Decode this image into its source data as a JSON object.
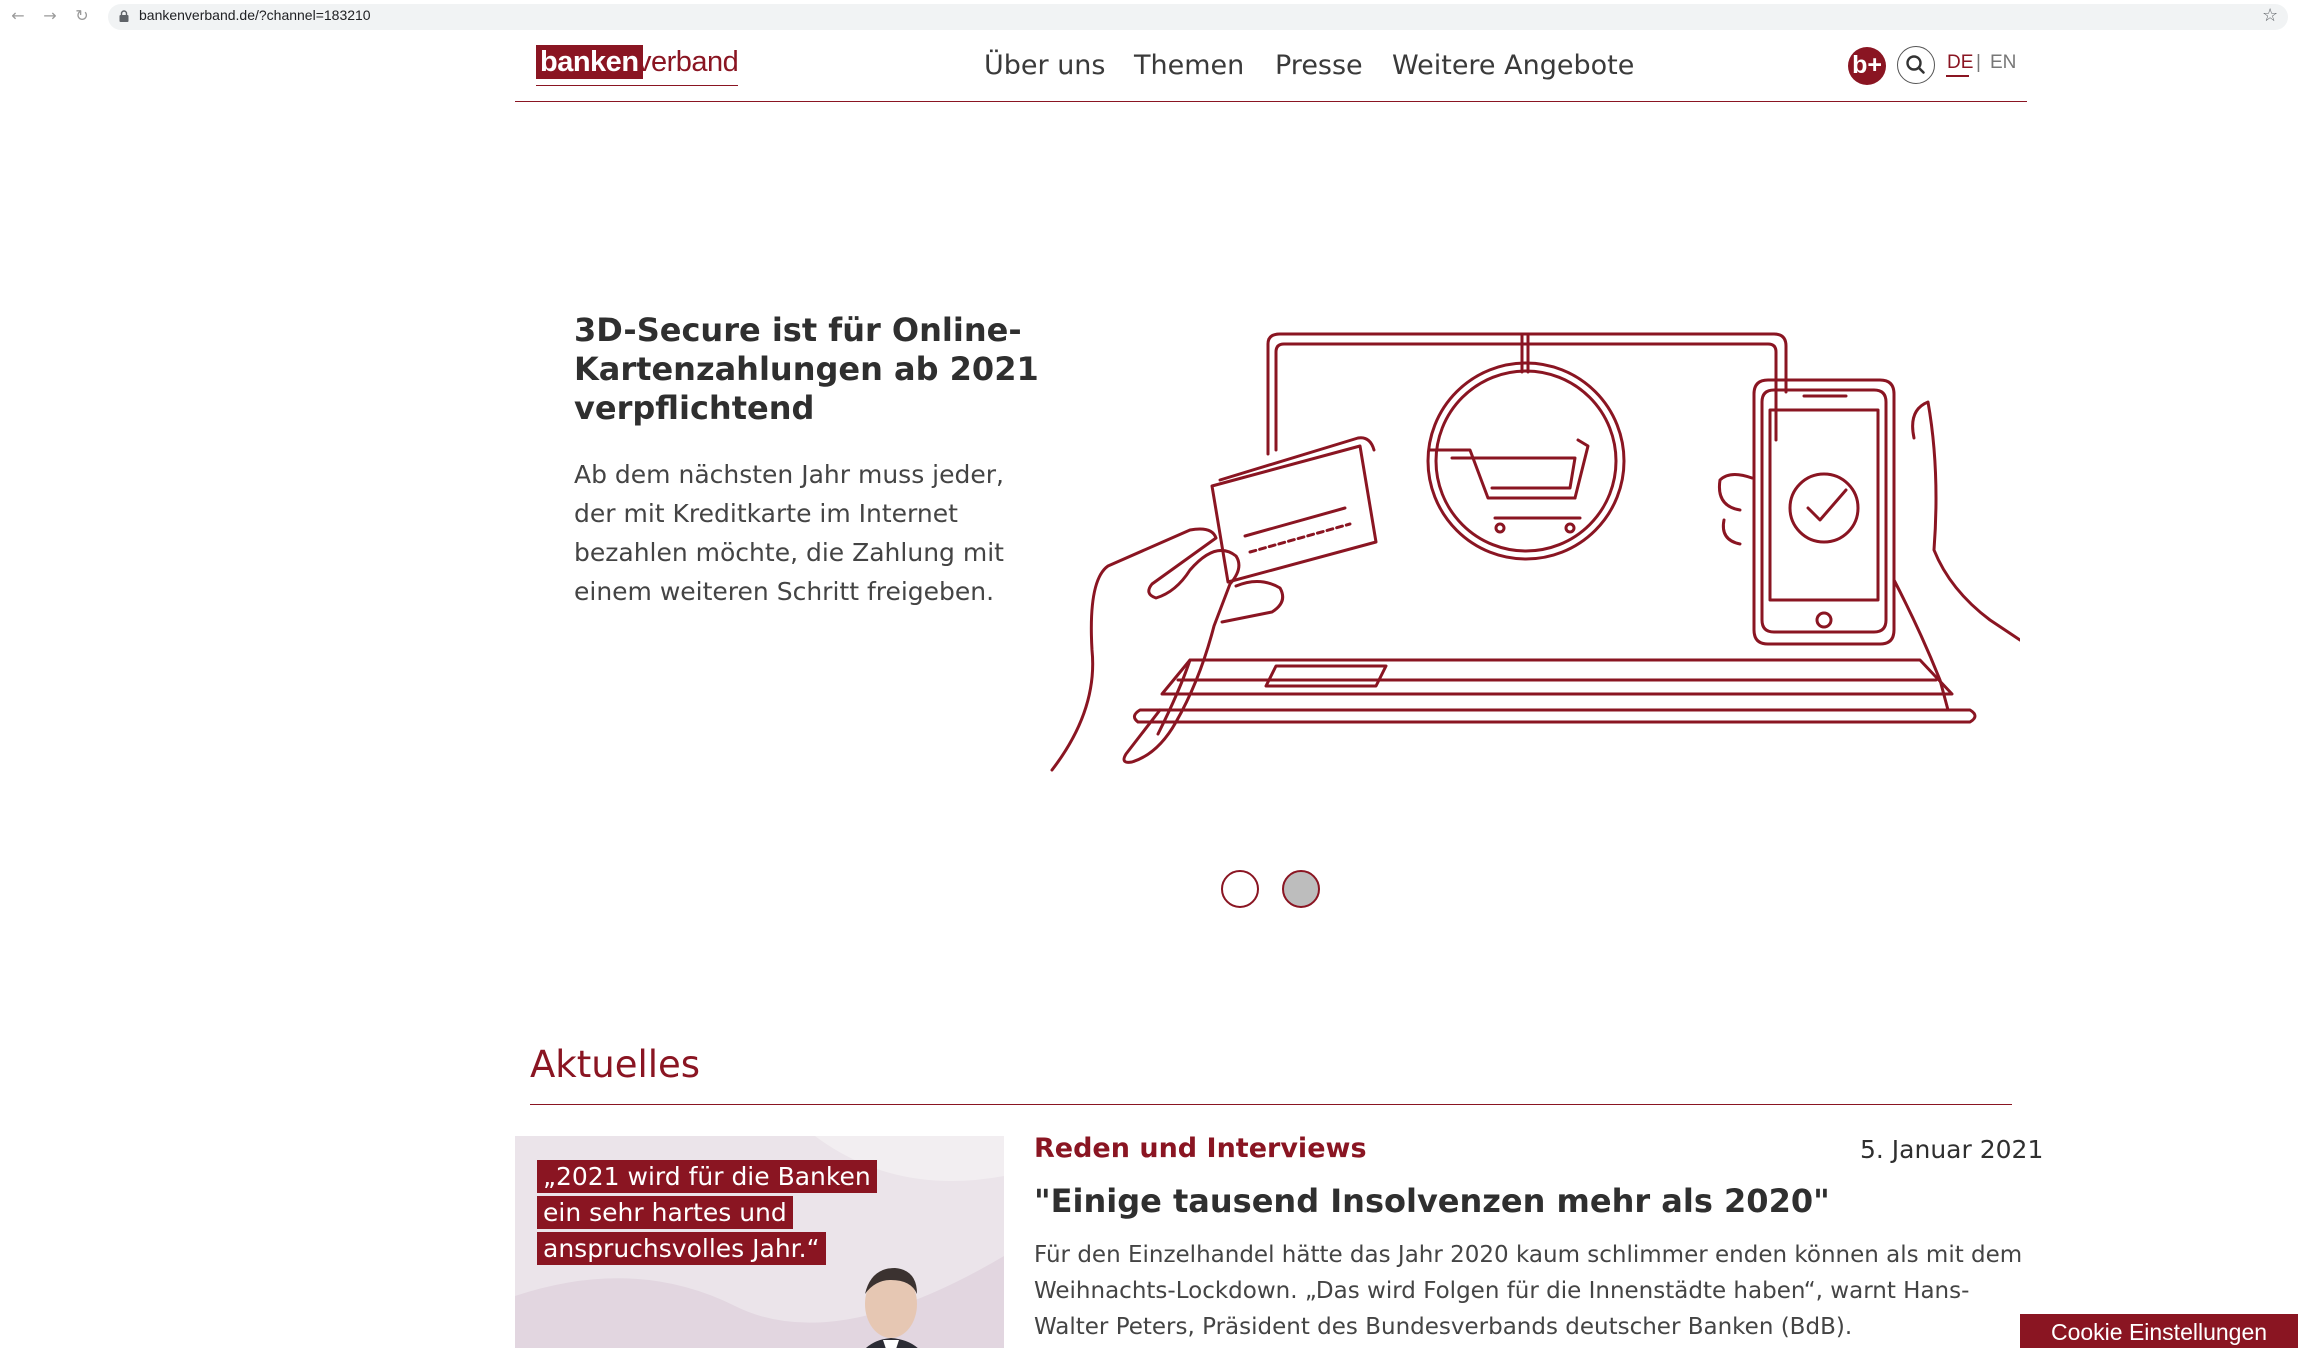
{
  "browser": {
    "url": "bankenverband.de/?channel=183210"
  },
  "header": {
    "logo": {
      "part1": "banken",
      "part2": "verband"
    },
    "nav": [
      "Über uns",
      "Themen",
      "Presse",
      "Weitere Angebote"
    ],
    "bplus_label": "b+",
    "lang": {
      "active": "DE",
      "separator": "|",
      "other": "EN"
    }
  },
  "hero": {
    "title": "3D-Secure ist für Online-Kartenzahlungen ab 2021 verpflichtend",
    "text": "Ab dem nächsten Jahr muss jeder, der mit Kreditkarte im Internet bezahlen möchte, die Zahlung mit einem weiteren Schritt freigeben.",
    "slides_total": 2,
    "slide_active": 2
  },
  "news": {
    "section_title": "Aktuelles",
    "item": {
      "image_quote": [
        "„2021 wird für die Banken",
        "ein sehr hartes und",
        "anspruchsvolles Jahr.“"
      ],
      "category": "Reden und Interviews",
      "date": "5. Januar 2021",
      "title": "\"Einige tausend Insolvenzen mehr als 2020\"",
      "text": "Für den Einzelhandel hätte das Jahr 2020 kaum schlimmer enden können als mit dem Weihnachts-Lockdown. „Das wird Folgen für die Innenstädte haben“, warnt Hans-Walter Peters, Präsident des Bundesverbands deutscher Banken (BdB)."
    }
  },
  "cookie_button": "Cookie Einstellungen",
  "colors": {
    "brand": "#8a1522"
  }
}
